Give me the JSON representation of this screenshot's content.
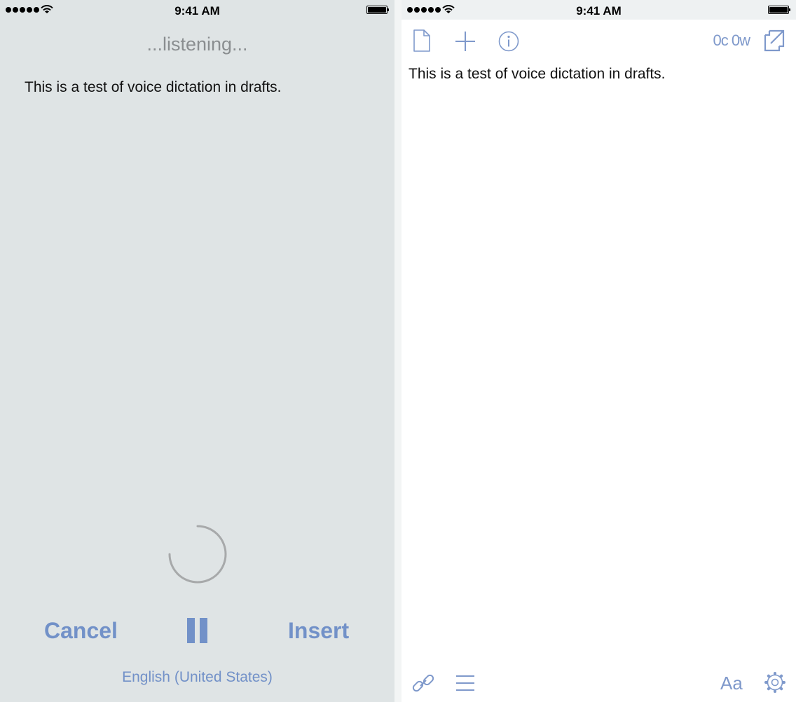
{
  "status_bar": {
    "time": "9:41 AM"
  },
  "dictation": {
    "listening_label": "...listening...",
    "text": "This is a test of voice dictation in drafts.",
    "cancel_label": "Cancel",
    "insert_label": "Insert",
    "language": "English (United States)"
  },
  "editor": {
    "count": "0c 0w",
    "text": "This is a test of voice dictation in drafts.",
    "font_label": "Aa"
  },
  "icons": {
    "left": [
      "signal-icon",
      "wifi-icon",
      "battery-icon",
      "spinner-icon",
      "pause-icon"
    ],
    "right": [
      "new-draft-icon",
      "add-icon",
      "info-icon",
      "expand-icon",
      "link-icon",
      "menu-icon",
      "gear-icon"
    ]
  },
  "colors": {
    "accent": "#7291c8",
    "left_background": "#dfe4e5",
    "right_background": "#ffffff",
    "muted_text": "#8a8e90"
  }
}
